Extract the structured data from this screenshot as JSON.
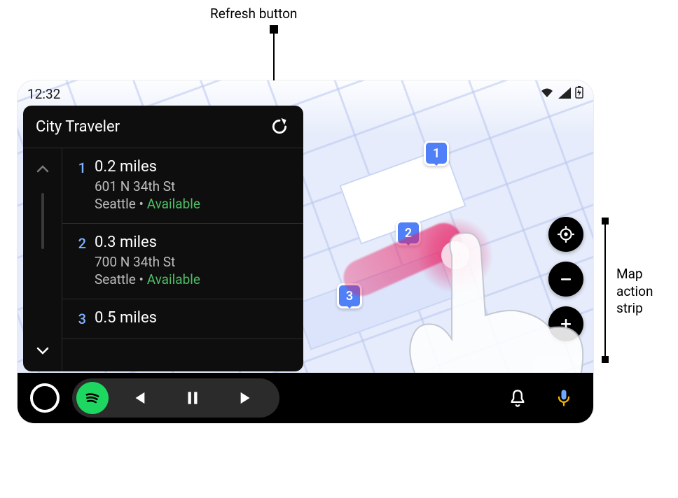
{
  "annotations": {
    "refresh": "Refresh button",
    "strip_l1": "Map",
    "strip_l2": "action",
    "strip_l3": "strip"
  },
  "statusbar": {
    "time": "12:32"
  },
  "card": {
    "title": "City Traveler",
    "items": [
      {
        "num": "1",
        "distance": "0.2 miles",
        "address": "601 N 34th St",
        "city": "Seattle",
        "status": "Available"
      },
      {
        "num": "2",
        "distance": "0.3 miles",
        "address": "700 N 34th St",
        "city": "Seattle",
        "status": "Available"
      },
      {
        "num": "3",
        "distance": "0.5 miles"
      }
    ]
  },
  "pins": {
    "p1": "1",
    "p2": "2",
    "p3": "3"
  },
  "sep": "•"
}
